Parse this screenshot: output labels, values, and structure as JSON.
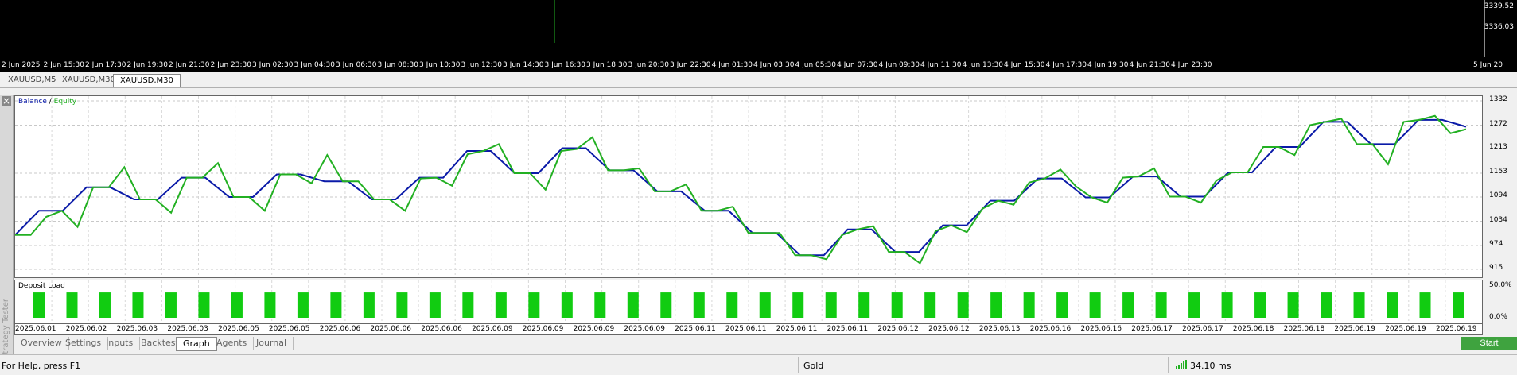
{
  "top_chart": {
    "prices": [
      "3339.52",
      "3336.03"
    ],
    "time_labels": [
      "2 Jun 2025",
      "2 Jun 15:30",
      "2 Jun 17:30",
      "2 Jun 19:30",
      "2 Jun 21:30",
      "2 Jun 23:30",
      "3 Jun 02:30",
      "3 Jun 04:30",
      "3 Jun 06:30",
      "3 Jun 08:30",
      "3 Jun 10:30",
      "3 Jun 12:30",
      "3 Jun 14:30",
      "3 Jun 16:30",
      "3 Jun 18:30",
      "3 Jun 20:30",
      "3 Jun 22:30",
      "4 Jun 01:30",
      "4 Jun 03:30",
      "4 Jun 05:30",
      "4 Jun 07:30",
      "4 Jun 09:30",
      "4 Jun 11:30",
      "4 Jun 13:30",
      "4 Jun 15:30",
      "4 Jun 17:30",
      "4 Jun 19:30",
      "4 Jun 21:30",
      "4 Jun 23:30",
      "5 Jun 20"
    ]
  },
  "chart_tabs": [
    {
      "label": "XAUUSD,M5"
    },
    {
      "label": "XAUUSD,M30"
    },
    {
      "label": "XAUUSD,M30"
    }
  ],
  "sidebar": {
    "title": "Strategy Tester",
    "close_glyph": "×"
  },
  "graph": {
    "legend_balance": "Balance",
    "legend_sep": " / ",
    "legend_equity": "Equity",
    "deposit_label": "Deposit Load",
    "deposit_axis": [
      "50.0%",
      "0.0%"
    ]
  },
  "colors": {
    "balance": "#0a1aa8",
    "equity": "#22b022",
    "load": "#11cc11"
  },
  "chart_data": {
    "type": "line",
    "y_ticks": [
      1332,
      1272,
      1213,
      1153,
      1094,
      1034,
      974,
      915
    ],
    "ylim": [
      915,
      1332
    ],
    "series": [
      {
        "name": "Balance",
        "values": [
          1000,
          1060,
          1060,
          1118,
          1118,
          1088,
          1088,
          1142,
          1142,
          1094,
          1094,
          1150,
          1150,
          1133,
          1133,
          1088,
          1088,
          1142,
          1142,
          1208,
          1208,
          1153,
          1153,
          1215,
          1215,
          1160,
          1160,
          1108,
          1108,
          1060,
          1060,
          1005,
          1005,
          950,
          950,
          1014,
          1014,
          958,
          958,
          1024,
          1024,
          1085,
          1085,
          1140,
          1140,
          1093,
          1093,
          1145,
          1145,
          1095,
          1095,
          1155,
          1155,
          1218,
          1218,
          1280,
          1280,
          1225,
          1225,
          1285,
          1285,
          1268
        ]
      },
      {
        "name": "Equity",
        "values": [
          1000,
          1000,
          1045,
          1060,
          1020,
          1118,
          1118,
          1168,
          1088,
          1088,
          1055,
          1142,
          1142,
          1178,
          1094,
          1094,
          1060,
          1150,
          1150,
          1128,
          1198,
          1133,
          1133,
          1088,
          1088,
          1060,
          1140,
          1142,
          1122,
          1200,
          1208,
          1225,
          1153,
          1153,
          1112,
          1208,
          1213,
          1242,
          1160,
          1160,
          1165,
          1108,
          1108,
          1125,
          1060,
          1060,
          1070,
          1005,
          1005,
          1005,
          950,
          950,
          940,
          1000,
          1014,
          1022,
          958,
          958,
          930,
          1010,
          1024,
          1007,
          1065,
          1085,
          1075,
          1130,
          1140,
          1162,
          1120,
          1093,
          1080,
          1142,
          1145,
          1165,
          1095,
          1095,
          1080,
          1135,
          1155,
          1155,
          1218,
          1218,
          1198,
          1272,
          1280,
          1288,
          1225,
          1225,
          1175,
          1280,
          1285,
          1295,
          1252,
          1262
        ]
      }
    ],
    "deposit_load_bars": [
      38,
      38,
      38,
      38,
      38,
      38,
      38,
      38,
      38,
      38,
      38,
      38,
      38,
      38,
      38,
      38,
      38,
      38,
      38,
      38,
      38,
      38,
      38,
      38,
      38,
      38,
      38,
      38,
      38,
      38,
      38,
      38,
      38,
      38,
      38,
      38,
      38,
      38,
      38,
      38,
      38,
      38,
      38,
      38
    ],
    "x_dates": [
      "2025.06.01",
      "2025.06.02",
      "2025.06.03",
      "2025.06.03",
      "2025.06.05",
      "2025.06.05",
      "2025.06.06",
      "2025.06.06",
      "2025.06.06",
      "2025.06.09",
      "2025.06.09",
      "2025.06.09",
      "2025.06.09",
      "2025.06.11",
      "2025.06.11",
      "2025.06.11",
      "2025.06.11",
      "2025.06.12",
      "2025.06.12",
      "2025.06.13",
      "2025.06.16",
      "2025.06.16",
      "2025.06.17",
      "2025.06.17",
      "2025.06.18",
      "2025.06.18",
      "2025.06.19",
      "2025.06.19",
      "2025.06.19"
    ]
  },
  "bottom_tabs": [
    {
      "label": "Overview"
    },
    {
      "label": "Settings"
    },
    {
      "label": "Inputs"
    },
    {
      "label": "Backtest"
    },
    {
      "label": "Graph"
    },
    {
      "label": "Agents"
    },
    {
      "label": "Journal"
    }
  ],
  "start_label": "Start",
  "status": {
    "help": "For Help, press F1",
    "symbol": "Gold",
    "ping": "34.10 ms"
  }
}
